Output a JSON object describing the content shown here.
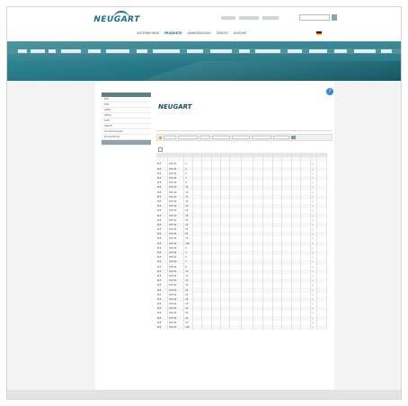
{
  "brand": {
    "logo": "NEUGART"
  },
  "header": {
    "top_links": [
      "",
      "",
      ""
    ],
    "search_placeholder": "",
    "nav": [
      "UNTERNEHMEN",
      "PRODUKTE",
      "ANWENDUNGEN",
      "SERVICE",
      "KONTAKT"
    ],
    "nav_active_index": 1,
    "right": {
      "login": "",
      "lang": "",
      "country": ""
    }
  },
  "breadcrumb": "",
  "sidebar": {
    "head": "",
    "items": [
      "PLE",
      "PLN",
      "WPLE",
      "WPLN",
      "PLFE",
      "WPLFE",
      "Sonderlösungen",
      "Produktfinder",
      ""
    ],
    "active_index": 8
  },
  "content": {
    "title": "",
    "help_text": "",
    "product": {
      "logo": "NEUGART",
      "title": "",
      "desc": ""
    },
    "section_title": "",
    "filter": {
      "labels": [
        "",
        "",
        "",
        "",
        "",
        "",
        ""
      ]
    },
    "show_all": ""
  },
  "table": {
    "headers": [
      "",
      "",
      "",
      "",
      "",
      "",
      "",
      "",
      "",
      "",
      "",
      "",
      "",
      "",
      "",
      "",
      ""
    ],
    "subheaders": [
      "",
      "",
      "",
      "",
      "",
      "",
      "",
      "",
      "",
      "",
      "",
      "",
      "",
      "",
      "",
      "",
      ""
    ],
    "rows": [
      [
        "PLE",
        "PLE 40",
        "3",
        "",
        "",
        "",
        "",
        "",
        "",
        "",
        "",
        "",
        "",
        "",
        "",
        "+",
        ""
      ],
      [
        "PLE",
        "PLE 40",
        "4",
        "",
        "",
        "",
        "",
        "",
        "",
        "",
        "",
        "",
        "",
        "",
        "",
        "+",
        ""
      ],
      [
        "PLE",
        "PLE 40",
        "5",
        "",
        "",
        "",
        "",
        "",
        "",
        "",
        "",
        "",
        "",
        "",
        "",
        "+",
        ""
      ],
      [
        "PLE",
        "PLE 40",
        "7",
        "",
        "",
        "",
        "",
        "",
        "",
        "",
        "",
        "",
        "",
        "",
        "",
        "+",
        ""
      ],
      [
        "PLE",
        "PLE 40",
        "8",
        "",
        "",
        "",
        "",
        "",
        "",
        "",
        "",
        "",
        "",
        "",
        "",
        "+",
        ""
      ],
      [
        "PLE",
        "PLE 40",
        "10",
        "",
        "",
        "",
        "",
        "",
        "",
        "",
        "",
        "",
        "",
        "",
        "",
        "+",
        ""
      ],
      [
        "PLE",
        "PLE 40",
        "12",
        "",
        "",
        "",
        "",
        "",
        "",
        "",
        "",
        "",
        "",
        "",
        "",
        "+",
        ""
      ],
      [
        "PLE",
        "PLE 40",
        "15",
        "",
        "",
        "",
        "",
        "",
        "",
        "",
        "",
        "",
        "",
        "",
        "",
        "+",
        ""
      ],
      [
        "PLE",
        "PLE 40",
        "16",
        "",
        "",
        "",
        "",
        "",
        "",
        "",
        "",
        "",
        "",
        "",
        "",
        "+",
        ""
      ],
      [
        "PLE",
        "PLE 40",
        "20",
        "",
        "",
        "",
        "",
        "",
        "",
        "",
        "",
        "",
        "",
        "",
        "",
        "+",
        ""
      ],
      [
        "PLE",
        "PLE 40",
        "25",
        "",
        "",
        "",
        "",
        "",
        "",
        "",
        "",
        "",
        "",
        "",
        "",
        "+",
        ""
      ],
      [
        "PLE",
        "PLE 40",
        "28",
        "",
        "",
        "",
        "",
        "",
        "",
        "",
        "",
        "",
        "",
        "",
        "",
        "+",
        ""
      ],
      [
        "PLE",
        "PLE 40",
        "35",
        "",
        "",
        "",
        "",
        "",
        "",
        "",
        "",
        "",
        "",
        "",
        "",
        "+",
        ""
      ],
      [
        "PLE",
        "PLE 40",
        "40",
        "",
        "",
        "",
        "",
        "",
        "",
        "",
        "",
        "",
        "",
        "",
        "",
        "+",
        ""
      ],
      [
        "PLE",
        "PLE 40",
        "50",
        "",
        "",
        "",
        "",
        "",
        "",
        "",
        "",
        "",
        "",
        "",
        "",
        "+",
        ""
      ],
      [
        "PLE",
        "PLE 40",
        "64",
        "",
        "",
        "",
        "",
        "",
        "",
        "",
        "",
        "",
        "",
        "",
        "",
        "+",
        ""
      ],
      [
        "PLE",
        "PLE 40",
        "70",
        "",
        "",
        "",
        "",
        "",
        "",
        "",
        "",
        "",
        "",
        "",
        "",
        "+",
        ""
      ],
      [
        "PLE",
        "PLE 40",
        "100",
        "",
        "",
        "",
        "",
        "",
        "",
        "",
        "",
        "",
        "",
        "",
        "",
        "+",
        ""
      ],
      [
        "PLE",
        "PLE 60",
        "3",
        "",
        "",
        "",
        "",
        "",
        "",
        "",
        "",
        "",
        "",
        "",
        "",
        "+",
        ""
      ],
      [
        "PLE",
        "PLE 60",
        "4",
        "",
        "",
        "",
        "",
        "",
        "",
        "",
        "",
        "",
        "",
        "",
        "",
        "+",
        ""
      ],
      [
        "PLE",
        "PLE 60",
        "5",
        "",
        "",
        "",
        "",
        "",
        "",
        "",
        "",
        "",
        "",
        "",
        "",
        "+",
        ""
      ],
      [
        "PLE",
        "PLE 60",
        "7",
        "",
        "",
        "",
        "",
        "",
        "",
        "",
        "",
        "",
        "",
        "",
        "",
        "+",
        ""
      ],
      [
        "PLE",
        "PLE 60",
        "8",
        "",
        "",
        "",
        "",
        "",
        "",
        "",
        "",
        "",
        "",
        "",
        "",
        "+",
        ""
      ],
      [
        "PLE",
        "PLE 60",
        "10",
        "",
        "",
        "",
        "",
        "",
        "",
        "",
        "",
        "",
        "",
        "",
        "",
        "+",
        ""
      ],
      [
        "PLE",
        "PLE 60",
        "12",
        "",
        "",
        "",
        "",
        "",
        "",
        "",
        "",
        "",
        "",
        "",
        "",
        "+",
        ""
      ],
      [
        "PLE",
        "PLE 60",
        "15",
        "",
        "",
        "",
        "",
        "",
        "",
        "",
        "",
        "",
        "",
        "",
        "",
        "+",
        ""
      ],
      [
        "PLE",
        "PLE 60",
        "16",
        "",
        "",
        "",
        "",
        "",
        "",
        "",
        "",
        "",
        "",
        "",
        "",
        "+",
        ""
      ],
      [
        "PLE",
        "PLE 60",
        "20",
        "",
        "",
        "",
        "",
        "",
        "",
        "",
        "",
        "",
        "",
        "",
        "",
        "+",
        ""
      ],
      [
        "PLE",
        "PLE 60",
        "25",
        "",
        "",
        "",
        "",
        "",
        "",
        "",
        "",
        "",
        "",
        "",
        "",
        "+",
        ""
      ],
      [
        "PLE",
        "PLE 60",
        "28",
        "",
        "",
        "",
        "",
        "",
        "",
        "",
        "",
        "",
        "",
        "",
        "",
        "+",
        ""
      ],
      [
        "PLE",
        "PLE 60",
        "35",
        "",
        "",
        "",
        "",
        "",
        "",
        "",
        "",
        "",
        "",
        "",
        "",
        "+",
        ""
      ],
      [
        "PLE",
        "PLE 60",
        "40",
        "",
        "",
        "",
        "",
        "",
        "",
        "",
        "",
        "",
        "",
        "",
        "",
        "+",
        ""
      ],
      [
        "PLE",
        "PLE 60",
        "50",
        "",
        "",
        "",
        "",
        "",
        "",
        "",
        "",
        "",
        "",
        "",
        "",
        "+",
        ""
      ],
      [
        "PLE",
        "PLE 60",
        "64",
        "",
        "",
        "",
        "",
        "",
        "",
        "",
        "",
        "",
        "",
        "",
        "",
        "+",
        ""
      ],
      [
        "PLE",
        "PLE 60",
        "70",
        "",
        "",
        "",
        "",
        "",
        "",
        "",
        "",
        "",
        "",
        "",
        "",
        "+",
        ""
      ],
      [
        "PLE",
        "PLE 60",
        "100",
        "",
        "",
        "",
        "",
        "",
        "",
        "",
        "",
        "",
        "",
        "",
        "",
        "+",
        ""
      ]
    ]
  },
  "footer": {
    "left": "",
    "right": [
      "",
      ""
    ]
  },
  "colors": {
    "accent": "#1a6f80",
    "band": "#2b7d8c",
    "cart": "#c0392b",
    "help": "#3a88c8"
  }
}
